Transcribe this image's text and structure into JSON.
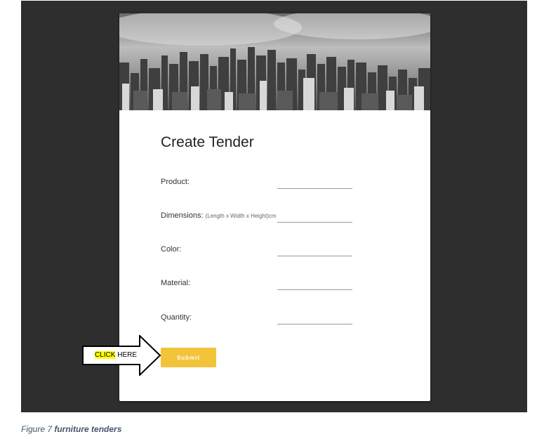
{
  "form": {
    "title": "Create Tender",
    "fields": [
      {
        "label": "Product:",
        "hint": "",
        "value": ""
      },
      {
        "label": "Dimensions:",
        "hint": "(Length x Width x Height)cm",
        "value": ""
      },
      {
        "label": "Color:",
        "hint": "",
        "value": ""
      },
      {
        "label": "Material:",
        "hint": "",
        "value": ""
      },
      {
        "label": "Quantity:",
        "hint": "",
        "value": ""
      }
    ],
    "submit_label": "Submit"
  },
  "callout": {
    "highlight": "CLICK",
    "rest": " HERE"
  },
  "caption": {
    "prefix": "Figure 7 ",
    "bold": "furniture tenders"
  },
  "colors": {
    "background": "#2e2e2e",
    "submit": "#f2c43a",
    "highlight": "#ffff00",
    "caption": "#44546a"
  }
}
